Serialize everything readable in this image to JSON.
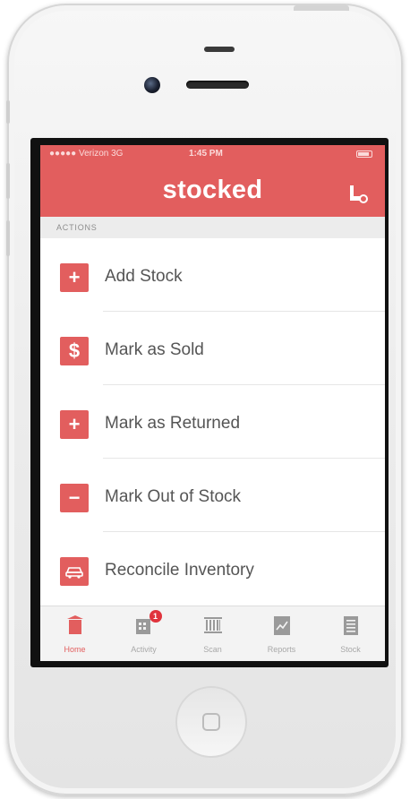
{
  "status_bar": {
    "carrier": "●●●●● Verizon  3G",
    "time": "1:45 PM"
  },
  "header": {
    "title": "stocked",
    "profile_icon": "user-settings-icon"
  },
  "section": {
    "title": "ACTIONS"
  },
  "actions": [
    {
      "label": "Add Stock",
      "icon": "plus-icon",
      "glyph": "+"
    },
    {
      "label": "Mark as Sold",
      "icon": "dollar-icon",
      "glyph": "$"
    },
    {
      "label": "Mark as Returned",
      "icon": "plus-icon",
      "glyph": "+"
    },
    {
      "label": "Mark Out of Stock",
      "icon": "minus-icon",
      "glyph": "−"
    },
    {
      "label": "Reconcile Inventory",
      "icon": "car-icon",
      "glyph": ""
    }
  ],
  "tabbar": {
    "tabs": [
      {
        "label": "Home",
        "icon": "bin-icon",
        "active": true
      },
      {
        "label": "Activity",
        "icon": "activity-icon",
        "badge": "1"
      },
      {
        "label": "Scan",
        "icon": "barcode-icon"
      },
      {
        "label": "Reports",
        "icon": "reports-icon"
      },
      {
        "label": "Stock",
        "icon": "list-icon"
      }
    ]
  },
  "colors": {
    "accent": "#e25e5e",
    "badge": "#e0333c"
  }
}
